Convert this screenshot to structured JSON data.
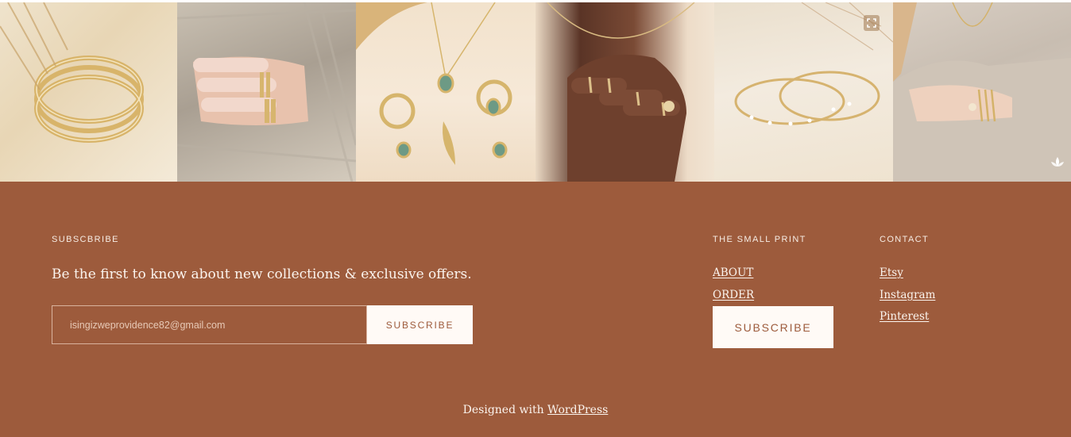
{
  "gallery": {
    "images": [
      {
        "alt": "gold stacked bangles on cream knit",
        "icon": "bangles"
      },
      {
        "alt": "hand with stacked rings on grey sweater",
        "icon": "rings"
      },
      {
        "alt": "gold necklace, rings and earrings with green stones",
        "icon": "set"
      },
      {
        "alt": "hand with dainty gold rings",
        "icon": "hand-rings"
      },
      {
        "alt": "gold bangles with crystals on cream fabric",
        "icon": "bangles-crystal"
      },
      {
        "alt": "model wearing layered bracelets and necklace",
        "icon": "model"
      }
    ]
  },
  "footer": {
    "subscribe": {
      "heading": "SUBSCBRIBE",
      "tagline": "Be the first to know about new collections & exclusive offers.",
      "email_value": "isingizweprovidence82@gmail.com",
      "button_label": "SUBSCRIBE"
    },
    "small_print": {
      "heading": "THE SMALL PRINT",
      "links": [
        "ABOUT",
        "ORDER"
      ],
      "button_label": "SUBSCRIBE"
    },
    "contact": {
      "heading": "CONTACT",
      "links": [
        "Etsy",
        "Instagram",
        "Pinterest"
      ]
    },
    "credit": {
      "prefix": "Designed with ",
      "link": "WordPress"
    }
  },
  "colors": {
    "footer_bg": "#9d5b3c",
    "button_bg": "#fffaf6",
    "button_text": "#9d5b3c"
  }
}
